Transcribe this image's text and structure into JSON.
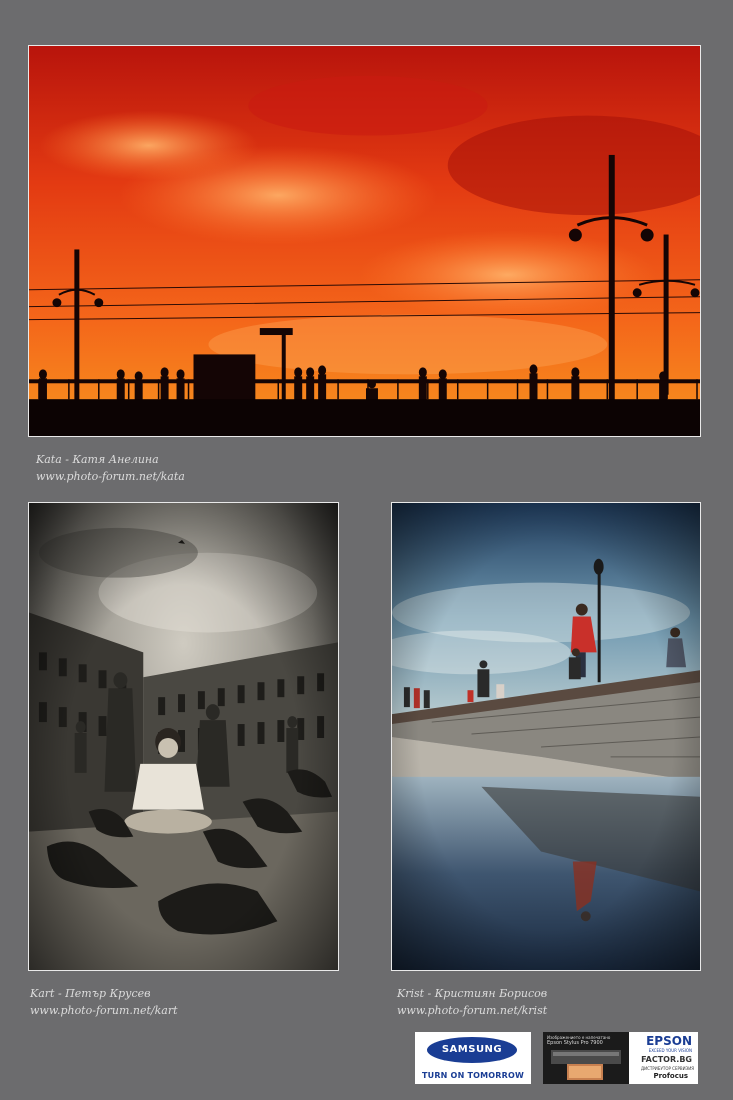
{
  "photos": [
    {
      "author": "Kata - Катя Анелина",
      "url": "www.photo-forum.net/kata",
      "subject": "bridge-sunset-silhouette"
    },
    {
      "author": "Kart - Петър Крусев",
      "url": "www.photo-forum.net/kart",
      "subject": "pigeons-square-bw"
    },
    {
      "author": "Krist - Кристиян Борисов",
      "url": "www.photo-forum.net/krist",
      "subject": "seawall-reflection"
    }
  ],
  "sponsors": {
    "samsung": {
      "logo": "SAMSUNG",
      "tagline": "TURN ON TOMORROW"
    },
    "epson": {
      "intro": "Изображението е напечатано",
      "printer": "Epson Stylus Pro 7900",
      "logo": "EPSON",
      "slogan": "EXCEED YOUR VISION",
      "factor": "FACTOR.BG",
      "distributor": "ДИСТРИБУТОР СЕРВИЗИЯ",
      "profocus": "Profocus"
    }
  },
  "colors": {
    "background": "#6c6c6e",
    "caption": "#dcdcdc",
    "border": "#e9e9e9",
    "samsung_blue": "#1a3d94"
  }
}
